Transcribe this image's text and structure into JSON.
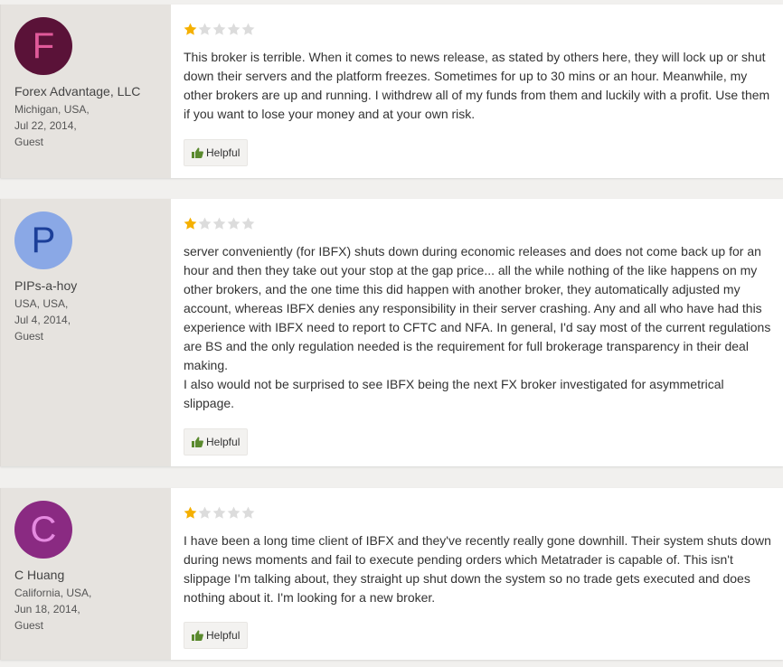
{
  "colors": {
    "star_filled": "#f5b000",
    "star_empty": "#dcdcdc",
    "thumb": "#5a8a2e"
  },
  "reviews": [
    {
      "avatar_letter": "F",
      "avatar_bg": "#5a1238",
      "avatar_fg": "#e05a9a",
      "name": "Forex Advantage, LLC",
      "location": "Michigan, USA,",
      "date": "Jul 22, 2014,",
      "role": "Guest",
      "rating": 1,
      "paragraphs": [
        "This broker is terrible. When it comes to news release, as stated by others here, they will lock up or shut down their servers and the platform freezes. Sometimes for up to 30 mins or an hour. Meanwhile, my other brokers are up and running. I withdrew all of my funds from them and luckily with a profit. Use them if you want to lose your money and at your own risk."
      ],
      "helpful_label": "Helpful"
    },
    {
      "avatar_letter": "P",
      "avatar_bg": "#8aa8e6",
      "avatar_fg": "#1c3f99",
      "name": "PIPs-a-hoy",
      "location": "USA, USA,",
      "date": "Jul 4, 2014,",
      "role": "Guest",
      "rating": 1,
      "paragraphs": [
        "server conveniently (for IBFX) shuts down during economic releases and does not come back up for an hour and then they take out your stop at the gap price... all the while nothing of the like happens on my other brokers, and the one time this did happen with another broker, they automatically adjusted my account, whereas IBFX denies any responsibility in their server crashing. Any and all who have had this experience with IBFX need to report to CFTC and NFA. In general, I'd say most of the current regulations are BS and the only regulation needed is the requirement for full brokerage transparency in their deal making.",
        "I also would not be surprised to see IBFX being the next FX broker investigated for asymmetrical slippage."
      ],
      "helpful_label": "Helpful"
    },
    {
      "avatar_letter": "C",
      "avatar_bg": "#8a2a82",
      "avatar_fg": "#e58ae0",
      "name": "C Huang",
      "location": "California, USA,",
      "date": "Jun 18, 2014,",
      "role": "Guest",
      "rating": 1,
      "paragraphs": [
        "I have been a long time client of IBFX and they've recently really gone downhill. Their system shuts down during news moments and fail to execute pending orders which Metatrader is capable of. This isn't slippage I'm talking about, they straight up shut down the system so no trade gets executed and does nothing about it. I'm looking for a new broker."
      ],
      "helpful_label": "Helpful"
    }
  ]
}
